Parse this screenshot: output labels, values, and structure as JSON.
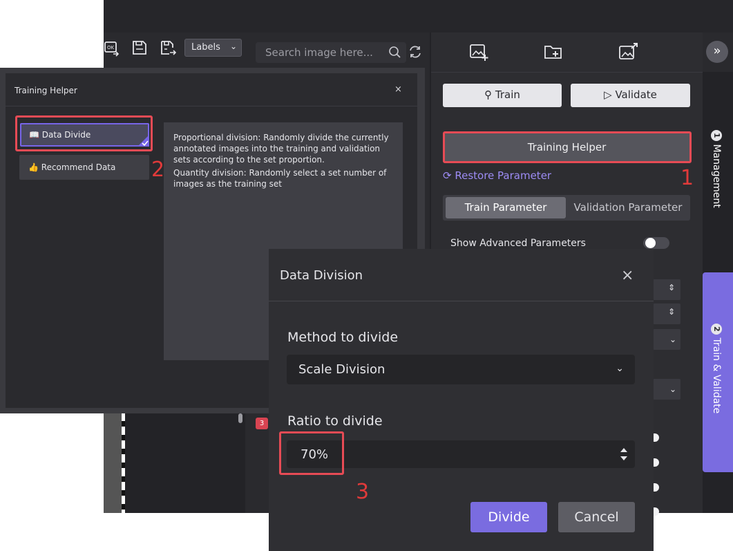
{
  "toolbar": {
    "labels_select": "Labels",
    "search_placeholder": "Search image here..."
  },
  "right_panel": {
    "train_label": "Train",
    "validate_label": "Validate",
    "training_helper_label": "Training Helper",
    "restore_label": "Restore Parameter",
    "tabs": [
      "Train Parameter",
      "Validation Parameter"
    ],
    "advanced_label": "Show Advanced Parameters"
  },
  "side_tabs": [
    {
      "num": "1",
      "label": "Management"
    },
    {
      "num": "2",
      "label": "Train & Validate"
    }
  ],
  "thumb_badge": "3",
  "training_helper": {
    "title": "Training Helper",
    "close": "×",
    "data_divide_label": "Data Divide",
    "recommend_label": "Recommend Data",
    "desc_1": "Proportional division: Randomly divide the currently annotated images into the training and validation sets according to the set proportion.",
    "desc_2": "Quantity division: Randomly select a set number of images as the training set"
  },
  "data_division": {
    "title": "Data Division",
    "close": "×",
    "method_label": "Method to divide",
    "method_value": "Scale Division",
    "ratio_label": "Ratio to divide",
    "ratio_value": "70%",
    "divide_label": "Divide",
    "cancel_label": "Cancel"
  },
  "annotations": [
    "1",
    "2",
    "3"
  ],
  "colors": {
    "accent": "#7a6ce0",
    "highlight": "#e74b55",
    "annotation": "#e03a3a",
    "link": "#9d8cf5"
  }
}
